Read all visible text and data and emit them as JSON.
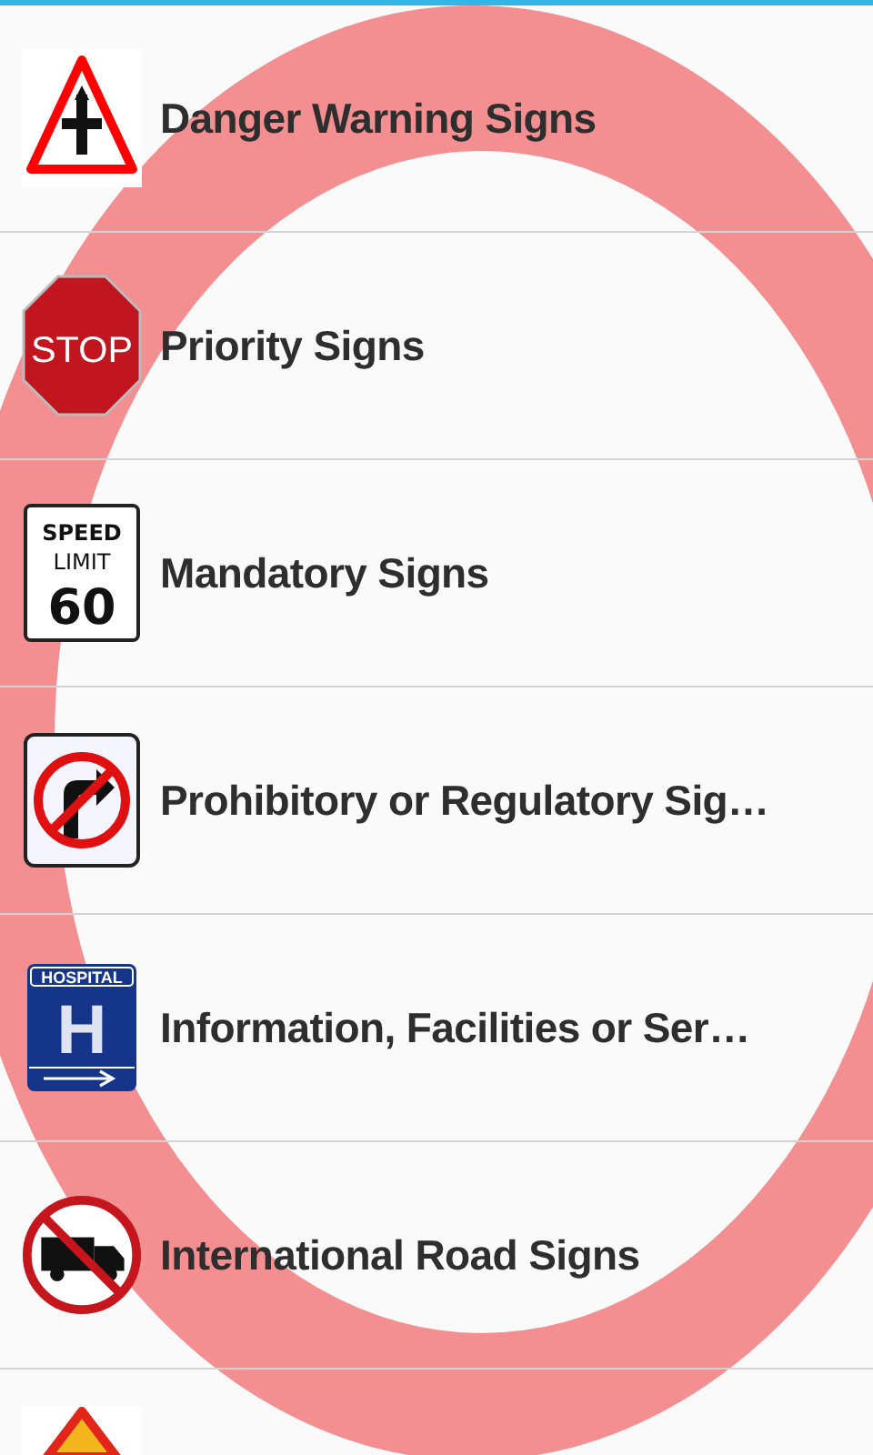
{
  "categories": [
    {
      "label": "Danger Warning Signs",
      "icon": {
        "kind": "triangle"
      }
    },
    {
      "label": "Priority Signs",
      "icon": {
        "kind": "stop",
        "texts": [
          "STOP"
        ]
      }
    },
    {
      "label": "Mandatory Signs",
      "icon": {
        "kind": "speed",
        "texts": [
          "SPEED",
          "LIMIT",
          "60"
        ]
      }
    },
    {
      "label": "Prohibitory or Regulatory Sig…",
      "icon": {
        "kind": "no_turn"
      }
    },
    {
      "label": "Information, Facilities or Ser…",
      "icon": {
        "kind": "hospital",
        "texts": [
          "HOSPITAL",
          "H"
        ]
      }
    },
    {
      "label": "International Road Signs",
      "icon": {
        "kind": "no_truck"
      }
    },
    {
      "icon": {
        "kind": "yellow_triangle"
      }
    }
  ]
}
